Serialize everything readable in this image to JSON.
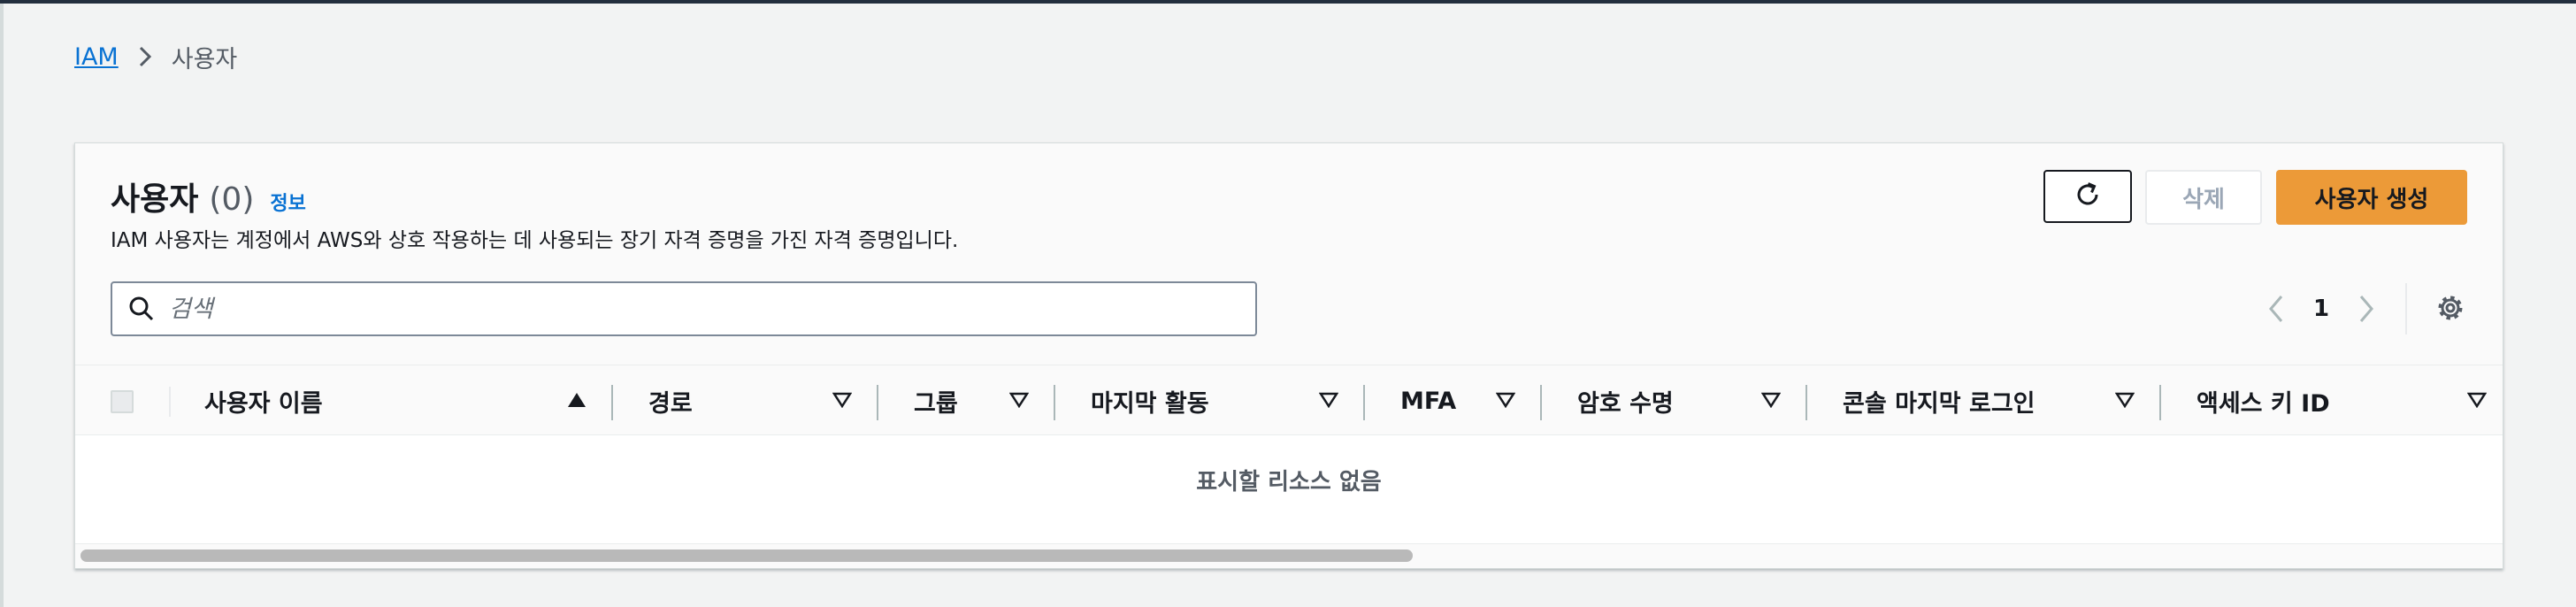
{
  "breadcrumb": {
    "root": "IAM",
    "current": "사용자"
  },
  "panel": {
    "title": "사용자",
    "count": "(0)",
    "info": "정보",
    "description": "IAM 사용자는 계정에서 AWS와 상호 작용하는 데 사용되는 장기 자격 증명을 가진 자격 증명입니다."
  },
  "actions": {
    "refresh_icon": "refresh-icon",
    "delete_label": "삭제",
    "create_label": "사용자 생성"
  },
  "search": {
    "placeholder": "검색",
    "value": ""
  },
  "pagination": {
    "current_page": "1"
  },
  "table": {
    "columns": [
      {
        "label": "사용자 이름",
        "sort": "ascending"
      },
      {
        "label": "경로",
        "sort": "none"
      },
      {
        "label": "그룹",
        "sort": "none"
      },
      {
        "label": "마지막 활동",
        "sort": "none"
      },
      {
        "label": "MFA",
        "sort": "none"
      },
      {
        "label": "암호 수명",
        "sort": "none"
      },
      {
        "label": "콘솔 마지막 로그인",
        "sort": "none"
      },
      {
        "label": "액세스 키 ID",
        "sort": "none"
      }
    ],
    "empty_message": "표시할 리소스 없음"
  },
  "colors": {
    "link": "#0972d3",
    "primary_button": "#ec9a38",
    "top_bar": "#232f3e"
  }
}
